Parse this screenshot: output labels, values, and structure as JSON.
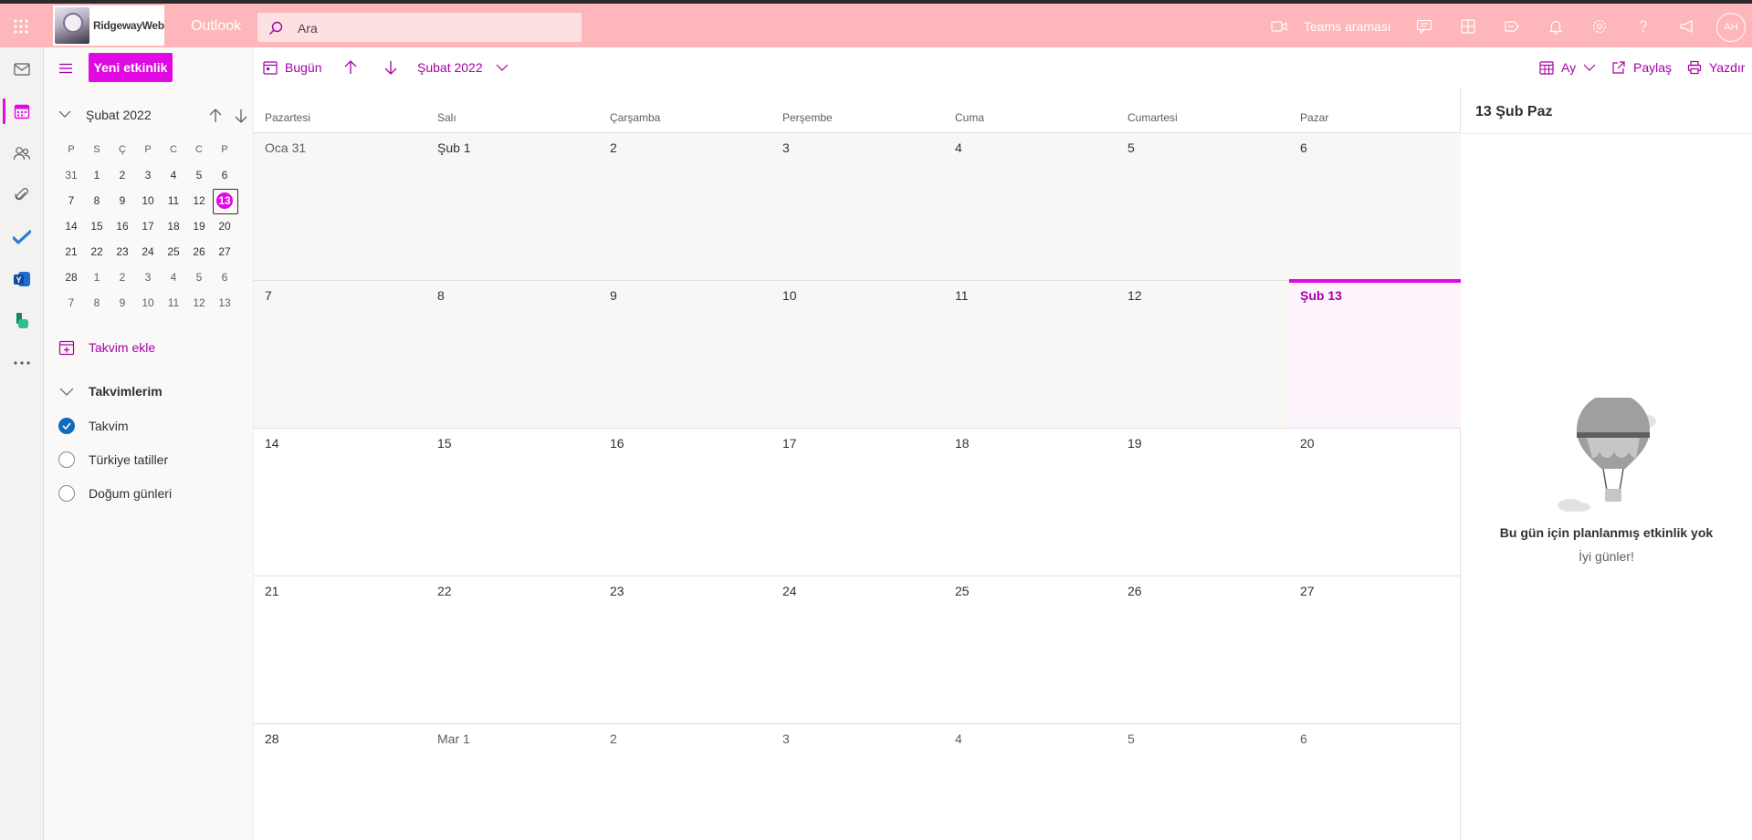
{
  "header": {
    "brand_text": "RidgewayWeb",
    "app_name": "Outlook",
    "search_placeholder": "Ara",
    "teams_label": "Teams araması",
    "avatar_initials": "AH",
    "accent_color": "#e008e3",
    "header_bg": "#fdb6ba"
  },
  "nav": {
    "new_event_label": "Yeni etkinlik",
    "mini_calendar": {
      "month_label": "Şubat 2022",
      "weekdays": [
        "P",
        "S",
        "Ç",
        "P",
        "C",
        "C",
        "P"
      ],
      "weeks": [
        [
          "31",
          "1",
          "2",
          "3",
          "4",
          "5",
          "6"
        ],
        [
          "7",
          "8",
          "9",
          "10",
          "11",
          "12",
          "13"
        ],
        [
          "14",
          "15",
          "16",
          "17",
          "18",
          "19",
          "20"
        ],
        [
          "21",
          "22",
          "23",
          "24",
          "25",
          "26",
          "27"
        ],
        [
          "28",
          "1",
          "2",
          "3",
          "4",
          "5",
          "6"
        ],
        [
          "7",
          "8",
          "9",
          "10",
          "11",
          "12",
          "13"
        ]
      ],
      "selected_day": "13"
    },
    "add_calendar_label": "Takvim ekle",
    "my_calendars_label": "Takvimlerim",
    "calendars": [
      {
        "label": "Takvim",
        "checked": true
      },
      {
        "label": "Türkiye tatiller",
        "checked": false
      },
      {
        "label": "Doğum günleri",
        "checked": false
      }
    ]
  },
  "toolbar": {
    "today_label": "Bugün",
    "month_label": "Şubat 2022",
    "view_label": "Ay",
    "share_label": "Paylaş",
    "print_label": "Yazdır"
  },
  "calendar": {
    "weekday_headers": [
      "Pazartesi",
      "Salı",
      "Çarşamba",
      "Perşembe",
      "Cuma",
      "Cumartesi",
      "Pazar"
    ],
    "weeks": [
      [
        "Oca 31",
        "Şub 1",
        "2",
        "3",
        "4",
        "5",
        "6"
      ],
      [
        "7",
        "8",
        "9",
        "10",
        "11",
        "12",
        "Şub 13"
      ],
      [
        "14",
        "15",
        "16",
        "17",
        "18",
        "19",
        "20"
      ],
      [
        "21",
        "22",
        "23",
        "24",
        "25",
        "26",
        "27"
      ],
      [
        "28",
        "Mar 1",
        "2",
        "3",
        "4",
        "5",
        "6"
      ]
    ]
  },
  "agenda": {
    "title": "13 Şub Paz",
    "empty_title": "Bu gün için planlanmış etkinlik yok",
    "empty_subtitle": "İyi günler!"
  }
}
